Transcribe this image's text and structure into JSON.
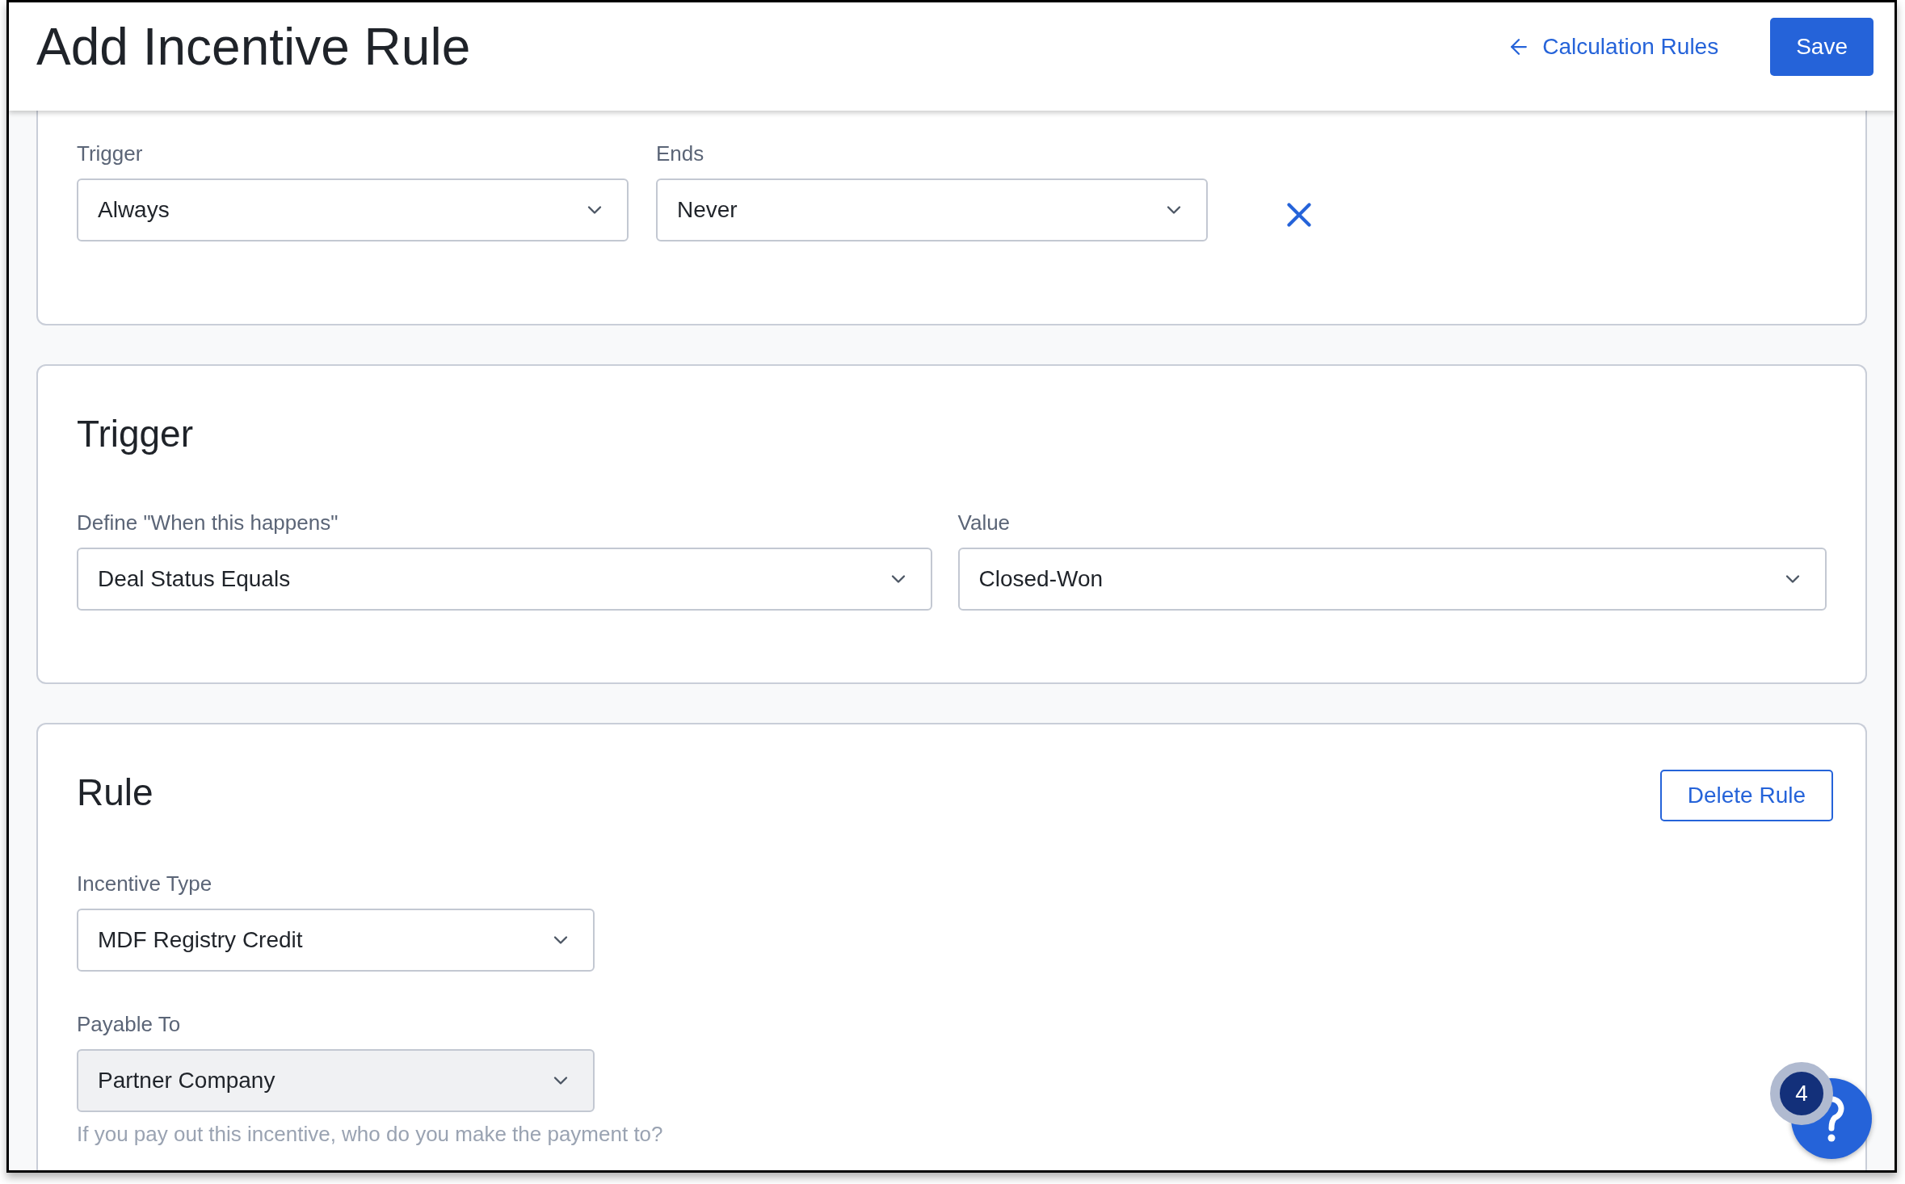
{
  "header": {
    "title": "Add Incentive Rule",
    "back_link": "Calculation Rules",
    "save_button": "Save"
  },
  "schedule": {
    "fields": [
      {
        "label": "Trigger",
        "value": "Always",
        "disabled": false
      },
      {
        "label": "Ends",
        "value": "Never",
        "disabled": false
      }
    ]
  },
  "trigger_section": {
    "title": "Trigger",
    "fields": [
      {
        "label": "Define \"When this happens\"",
        "value": "Deal Status Equals",
        "disabled": false
      },
      {
        "label": "Value",
        "value": "Closed-Won",
        "disabled": false
      }
    ]
  },
  "rule_section": {
    "title": "Rule",
    "delete_button": "Delete Rule",
    "fields": [
      {
        "label": "Incentive Type",
        "value": "MDF Registry Credit",
        "disabled": false
      },
      {
        "label": "Payable To",
        "value": "Partner Company",
        "disabled": true,
        "help": "If you pay out this incentive, who do you make the payment to?"
      }
    ]
  },
  "help_widget": {
    "badge": "4"
  }
}
